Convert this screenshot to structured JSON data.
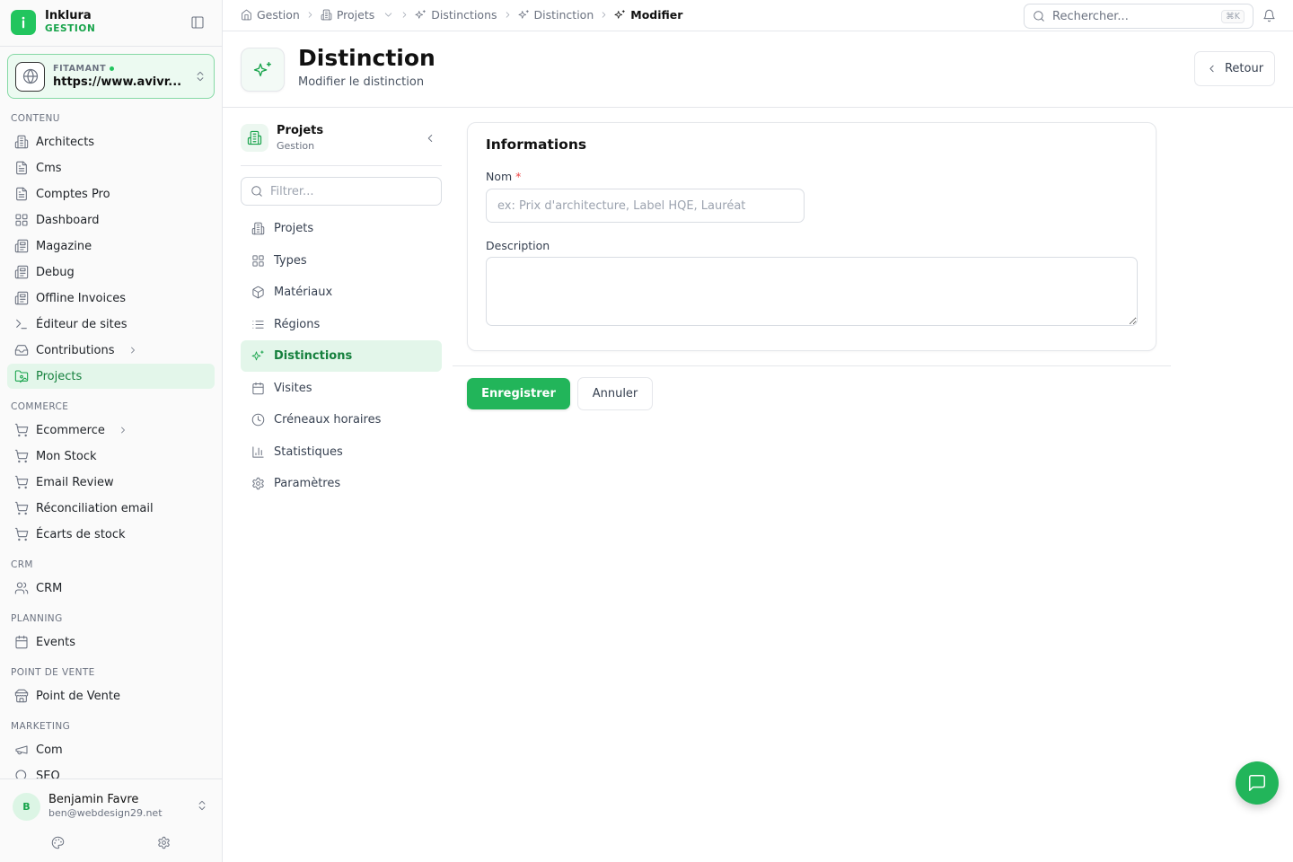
{
  "app": {
    "name": "Inklura",
    "subtitle": "GESTION"
  },
  "site": {
    "label": "FITAMANT",
    "url": "https://www.avivr..."
  },
  "sidebar": {
    "sections": [
      {
        "title": "CONTENU",
        "items": [
          {
            "label": "Architects",
            "icon": "building-icon"
          },
          {
            "label": "Cms",
            "icon": "file-icon"
          },
          {
            "label": "Comptes Pro",
            "icon": "file-icon"
          },
          {
            "label": "Dashboard",
            "icon": "grid-icon"
          },
          {
            "label": "Magazine",
            "icon": "newspaper-icon"
          },
          {
            "label": "Debug",
            "icon": "newspaper-icon"
          },
          {
            "label": "Offline Invoices",
            "icon": "newspaper-icon"
          },
          {
            "label": "Éditeur de sites",
            "icon": "terminal-icon"
          },
          {
            "label": "Contributions",
            "icon": "inbox-icon"
          },
          {
            "label": "Projects",
            "icon": "folder-image-icon"
          }
        ]
      },
      {
        "title": "COMMERCE",
        "items": [
          {
            "label": "Ecommerce",
            "icon": "cart-icon"
          },
          {
            "label": "Mon Stock",
            "icon": "cart-icon"
          },
          {
            "label": "Email Review",
            "icon": "cart-icon"
          },
          {
            "label": "Réconciliation email",
            "icon": "cart-icon"
          },
          {
            "label": "Écarts de stock",
            "icon": "cart-icon"
          }
        ]
      },
      {
        "title": "CRM",
        "items": [
          {
            "label": "CRM",
            "icon": "users-icon"
          }
        ]
      },
      {
        "title": "PLANNING",
        "items": [
          {
            "label": "Events",
            "icon": "calendar-icon"
          }
        ]
      },
      {
        "title": "POINT DE VENTE",
        "items": [
          {
            "label": "Point de Vente",
            "icon": "store-icon"
          }
        ]
      },
      {
        "title": "MARKETING",
        "items": [
          {
            "label": "Com",
            "icon": "megaphone-icon"
          },
          {
            "label": "SEO",
            "icon": "search-icon"
          }
        ]
      }
    ],
    "active": "Projects"
  },
  "user": {
    "initial": "B",
    "name": "Benjamin Favre",
    "email": "ben@webdesign29.net"
  },
  "breadcrumbs": [
    {
      "label": "Gestion",
      "icon": "home-icon"
    },
    {
      "label": "Projets",
      "icon": "building-icon"
    },
    {
      "label": "Distinctions",
      "icon": "sparkles-icon"
    },
    {
      "label": "Distinction",
      "icon": "sparkles-icon"
    },
    {
      "label": "Modifier",
      "icon": "sparkles-icon"
    }
  ],
  "search": {
    "placeholder": "Rechercher...",
    "shortcut": "⌘K"
  },
  "header": {
    "title": "Distinction",
    "subtitle": "Modifier le distinction",
    "back_label": "Retour"
  },
  "subnav": {
    "title": "Projets",
    "subtitle": "Gestion",
    "filter_placeholder": "Filtrer...",
    "items": [
      {
        "label": "Projets",
        "icon": "building-icon"
      },
      {
        "label": "Types",
        "icon": "grid-icon"
      },
      {
        "label": "Matériaux",
        "icon": "box-icon"
      },
      {
        "label": "Régions",
        "icon": "list-icon"
      },
      {
        "label": "Distinctions",
        "icon": "sparkles-icon"
      },
      {
        "label": "Visites",
        "icon": "calendar-icon"
      },
      {
        "label": "Créneaux horaires",
        "icon": "clock-icon"
      },
      {
        "label": "Statistiques",
        "icon": "bar-chart-icon"
      },
      {
        "label": "Paramètres",
        "icon": "gear-icon"
      }
    ],
    "active": "Distinctions"
  },
  "form": {
    "section_title": "Informations",
    "name_label": "Nom",
    "required_mark": "*",
    "name_value": "",
    "name_placeholder": "ex: Prix d'architecture, Label HQE, Lauréat",
    "description_label": "Description",
    "description_value": "",
    "save_label": "Enregistrer",
    "cancel_label": "Annuler"
  },
  "colors": {
    "accent": "#22c55e",
    "accent_dark": "#16a34a",
    "active_bg": "#e3f6ea"
  }
}
